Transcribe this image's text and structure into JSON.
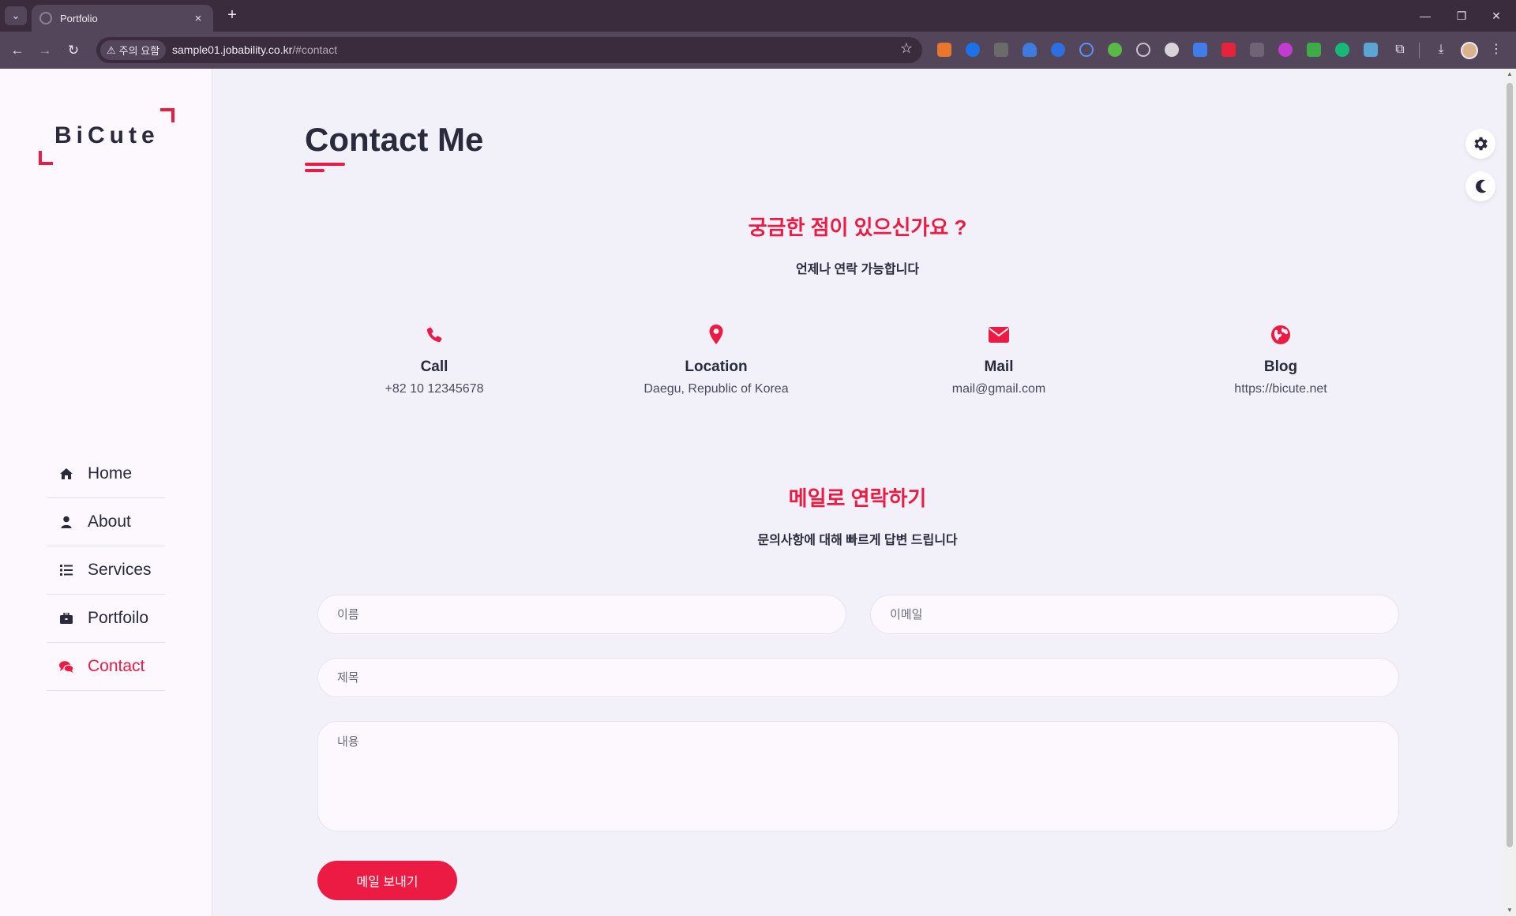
{
  "browser": {
    "tab_title": "Portfolio",
    "tab_close": "×",
    "new_tab": "+",
    "security_label": "주의 요함",
    "url_host": "sample01.jobability.co.kr",
    "url_path": "/#contact"
  },
  "sidebar": {
    "logo": "BiCute",
    "items": [
      {
        "label": "Home",
        "icon": "home-icon"
      },
      {
        "label": "About",
        "icon": "user-icon"
      },
      {
        "label": "Services",
        "icon": "list-icon"
      },
      {
        "label": "Portfoilo",
        "icon": "briefcase-icon"
      },
      {
        "label": "Contact",
        "icon": "comments-icon",
        "active": true
      }
    ]
  },
  "main": {
    "title": "Contact Me",
    "question_heading": "궁금한 점이 있으신가요 ?",
    "question_sub": "언제나 연락 가능합니다",
    "info": [
      {
        "label": "Call",
        "value": "+82 10 12345678",
        "icon": "phone-icon"
      },
      {
        "label": "Location",
        "value": "Daegu, Republic of Korea",
        "icon": "map-marker-icon"
      },
      {
        "label": "Mail",
        "value": "mail@gmail.com",
        "icon": "envelope-icon"
      },
      {
        "label": "Blog",
        "value": "https://bicute.net",
        "icon": "globe-icon"
      }
    ],
    "mail_heading": "메일로 연락하기",
    "mail_sub": "문의사항에 대해 빠르게 답변 드립니다",
    "form": {
      "name_placeholder": "이름",
      "email_placeholder": "이메일",
      "subject_placeholder": "제목",
      "message_placeholder": "내용",
      "submit_label": "메일 보내기"
    }
  },
  "colors": {
    "accent": "#ec1b43",
    "text_dark": "#2b2a3d",
    "page_bg": "#f2f1fa",
    "sidebar_bg": "#fdf8fe",
    "chrome_dark": "#3a2c3d",
    "chrome_toolbar": "#54465a"
  }
}
